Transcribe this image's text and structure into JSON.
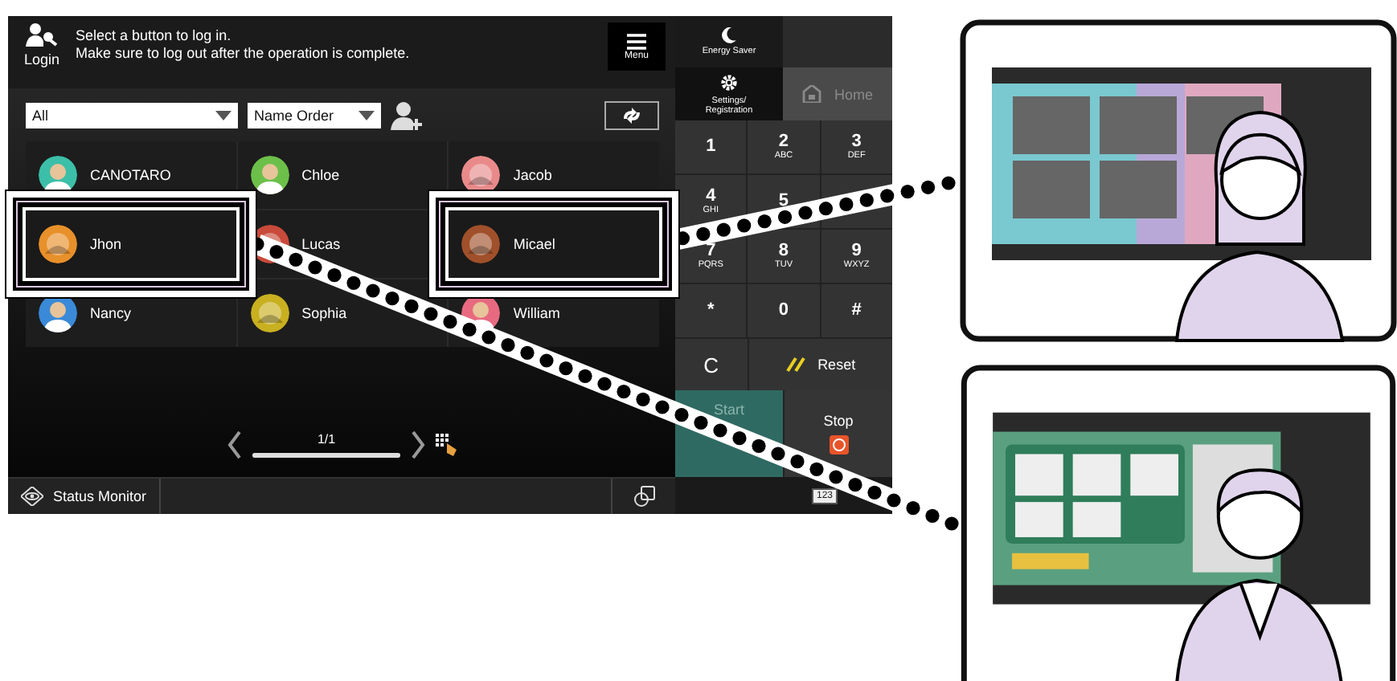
{
  "header": {
    "title": "Login",
    "message_lines": [
      "Select a button to log in.",
      "Make sure to log out after the operation is complete."
    ],
    "menu_label": "Menu"
  },
  "filters": [
    {
      "value": "All"
    },
    {
      "value": "Name Order"
    }
  ],
  "users": [
    {
      "name": "CANOTARO",
      "kind": "person",
      "color": "#3cbfa8",
      "highlighted": false
    },
    {
      "name": "Chloe",
      "kind": "person",
      "color": "#6cc04a",
      "highlighted": false
    },
    {
      "name": "Jacob",
      "kind": "picture",
      "color": "#e98a8a",
      "highlighted": false
    },
    {
      "name": "Jhon",
      "kind": "picture",
      "color": "#e8902a",
      "highlighted": true
    },
    {
      "name": "Lucas",
      "kind": "picture",
      "color": "#c84a3a",
      "highlighted": false
    },
    {
      "name": "Micael",
      "kind": "picture",
      "color": "#a0502a",
      "highlighted": true
    },
    {
      "name": "Nancy",
      "kind": "person",
      "color": "#3a8ad8",
      "highlighted": false
    },
    {
      "name": "Sophia",
      "kind": "picture",
      "color": "#c8b020",
      "highlighted": false
    },
    {
      "name": "William",
      "kind": "person",
      "color": "#e86a80",
      "highlighted": false
    }
  ],
  "pager": {
    "page": "1/1",
    "level": 1
  },
  "status_bar": {
    "label": "Status Monitor"
  },
  "side_panel": {
    "energy_saver": "Energy Saver",
    "settings_lines": [
      "Settings/",
      "Registration"
    ],
    "home": "Home"
  },
  "keypad": [
    {
      "key": "1"
    },
    {
      "key": "2",
      "letters": "ABC"
    },
    {
      "key": "3",
      "letters": "DEF"
    },
    {
      "key": "4",
      "letters": "GHI"
    },
    {
      "key": "5"
    },
    {
      "kind": "covered"
    },
    {
      "key": "7",
      "letters": "PQRS"
    },
    {
      "key": "8",
      "letters": "TUV"
    },
    {
      "key": "9",
      "letters": "WXYZ"
    },
    {
      "key": "*"
    },
    {
      "key": "0"
    },
    {
      "key": "#"
    }
  ],
  "controls": {
    "clear": "C",
    "reset": "Reset",
    "start": "Start",
    "stop": "Stop",
    "input_mode": "123"
  },
  "examples": [
    {
      "kind": "home-screen"
    },
    {
      "kind": "send-screen"
    }
  ]
}
